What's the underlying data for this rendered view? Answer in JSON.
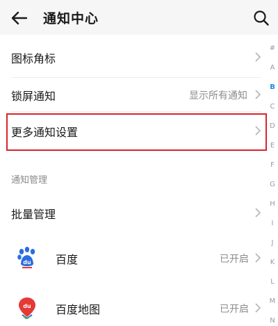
{
  "header": {
    "title": "通知中心",
    "back_icon": "arrow-left-icon",
    "search_icon": "search-icon"
  },
  "settings": {
    "badge_label": "图标角标",
    "lock_label": "锁屏通知",
    "lock_value": "显示所有通知",
    "more_label": "更多通知设置"
  },
  "section": {
    "title": "通知管理"
  },
  "batch": {
    "label": "批量管理"
  },
  "apps": [
    {
      "name": "百度",
      "status": "已开启",
      "icon": "baidu-paw-icon"
    },
    {
      "name": "百度地图",
      "status": "已开启",
      "icon": "baidu-map-icon"
    }
  ],
  "index_bar": [
    "#",
    "A",
    "B",
    "C",
    "D",
    "E",
    "F",
    "G",
    "H",
    "I",
    "J",
    "K",
    "L",
    "M",
    "N"
  ],
  "index_active": "B",
  "colors": {
    "highlight_border": "#d9232a",
    "accent": "#1e88e5",
    "baidu_blue": "#2b6de0",
    "baidu_red": "#e53935"
  }
}
